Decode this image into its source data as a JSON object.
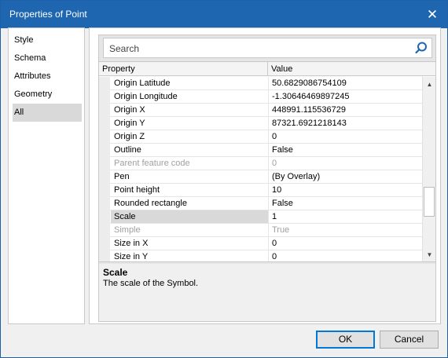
{
  "window": {
    "title": "Properties of Point",
    "close_glyph": "✕"
  },
  "nav": {
    "items": [
      {
        "label": "Style"
      },
      {
        "label": "Schema"
      },
      {
        "label": "Attributes"
      },
      {
        "label": "Geometry"
      },
      {
        "label": "All",
        "selected": true
      }
    ]
  },
  "search": {
    "placeholder": "Search",
    "icon": "search-icon"
  },
  "grid": {
    "header": {
      "property": "Property",
      "value": "Value"
    },
    "rows": [
      {
        "name": "Origin Latitude",
        "value": "50.6829086754109"
      },
      {
        "name": "Origin Longitude",
        "value": "-1.30646469897245"
      },
      {
        "name": "Origin X",
        "value": "448991.115536729"
      },
      {
        "name": "Origin Y",
        "value": "87321.6921218143"
      },
      {
        "name": "Origin Z",
        "value": "0"
      },
      {
        "name": "Outline",
        "value": "False"
      },
      {
        "name": "Parent feature code",
        "value": "0",
        "disabled": true
      },
      {
        "name": "Pen",
        "value": " (By Overlay)"
      },
      {
        "name": "Point height",
        "value": "10"
      },
      {
        "name": "Rounded rectangle",
        "value": "False"
      },
      {
        "name": "Scale",
        "value": "1",
        "selected": true
      },
      {
        "name": "Simple",
        "value": "True",
        "disabled": true
      },
      {
        "name": "Size in X",
        "value": "0"
      },
      {
        "name": "Size in Y",
        "value": "0"
      }
    ]
  },
  "description": {
    "title": "Scale",
    "text": "The scale of the Symbol."
  },
  "buttons": {
    "ok": "OK",
    "cancel": "Cancel"
  },
  "colors": {
    "titlebar": "#1f66b0",
    "selection": "#d9d9d9",
    "disabled_text": "#a0a0a0",
    "accent": "#0078d7"
  }
}
